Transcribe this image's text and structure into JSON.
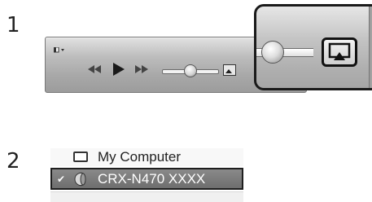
{
  "steps": [
    {
      "number": "1"
    },
    {
      "number": "2"
    }
  ],
  "toolbar": {
    "controls": [
      "view-menu-icon",
      "rewind-icon",
      "play-icon",
      "fast-forward-icon",
      "volume-slider",
      "airplay-icon"
    ]
  },
  "speakers": {
    "items": [
      {
        "label": "My Computer",
        "icon": "monitor-icon",
        "selected": false
      },
      {
        "label": "CRX-N470 XXXX",
        "icon": "speaker-icon",
        "selected": true
      }
    ]
  },
  "colors": {
    "toolbar": "#b0b0b0",
    "selected_row": "#7a7a7a",
    "callout_border": "#1a1a1a"
  }
}
